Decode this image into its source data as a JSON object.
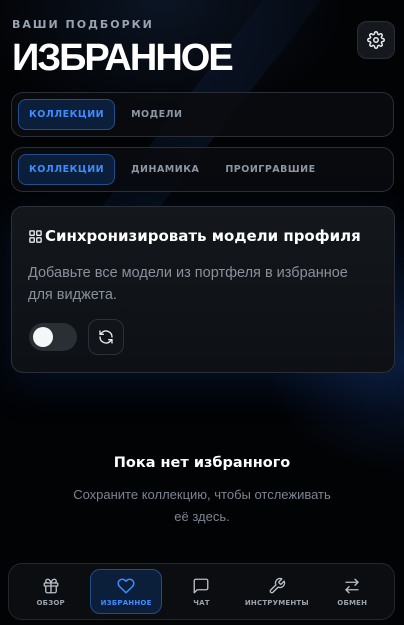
{
  "header": {
    "eyebrow": "ВАШИ ПОДБОРКИ",
    "title": "ИЗБРАННОЕ",
    "settings_icon": "gear-icon"
  },
  "primary_tabs": [
    {
      "label": "КОЛЛЕКЦИИ",
      "active": true
    },
    {
      "label": "МОДЕЛИ",
      "active": false
    }
  ],
  "secondary_tabs": [
    {
      "label": "КОЛЛЕКЦИИ",
      "active": true
    },
    {
      "label": "ДИНАМИКА",
      "active": false
    },
    {
      "label": "ПРОИГРАВШИЕ",
      "active": false
    }
  ],
  "sync_card": {
    "icon": "grid-icon",
    "title": "Синхронизировать модели профиля",
    "description": "Добавьте все модели из портфеля в избранное для виджета.",
    "toggle_on": false,
    "refresh_icon": "refresh-icon"
  },
  "empty_state": {
    "title": "Пока нет избранного",
    "description": "Сохраните коллекцию, чтобы отслеживать её здесь."
  },
  "bottom_nav": [
    {
      "label": "ОБЗОР",
      "icon": "gift-icon",
      "active": false
    },
    {
      "label": "ИЗБРАННОЕ",
      "icon": "heart-icon",
      "active": true
    },
    {
      "label": "ЧАТ",
      "icon": "chat-icon",
      "active": false
    },
    {
      "label": "ИНСТРУМЕНТЫ",
      "icon": "wrench-icon",
      "active": false
    },
    {
      "label": "ОБМЕН",
      "icon": "swap-icon",
      "active": false
    }
  ],
  "colors": {
    "accent": "#3f8cff",
    "background": "#020305",
    "card": "#14171c"
  }
}
